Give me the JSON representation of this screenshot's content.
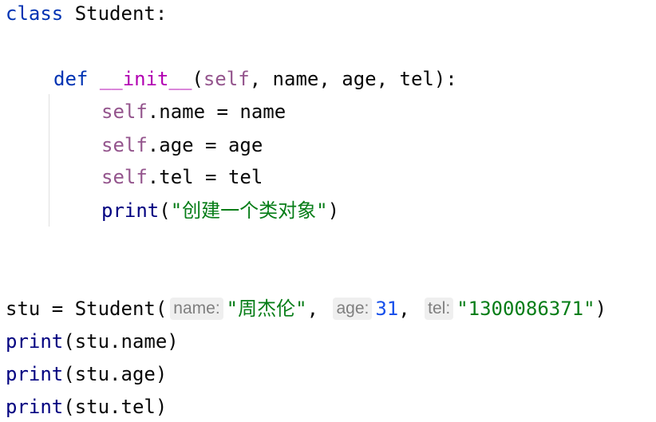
{
  "code": {
    "line1": {
      "kw": "class",
      "name": " Student:"
    },
    "line3": {
      "kw": "def",
      "space": " ",
      "fn": "__init__",
      "open": "(",
      "self": "self",
      "params": ", name, age, tel):"
    },
    "line4": {
      "self": "self",
      "rest": ".name = name"
    },
    "line5": {
      "self": "self",
      "rest": ".age = age"
    },
    "line6": {
      "self": "self",
      "rest": ".tel = tel"
    },
    "line7": {
      "fn": "print",
      "open": "(",
      "str": "\"创建一个类对象\"",
      "close": ")"
    },
    "line10": {
      "prefix": "stu = Student(",
      "hint_name": "name:",
      "arg_name": "\"周杰伦\"",
      "sep1": ", ",
      "hint_age": "age:",
      "arg_age": "31",
      "sep2": ", ",
      "hint_tel": "tel:",
      "arg_tel": "\"1300086371\"",
      "close": ")"
    },
    "line11": {
      "fn": "print",
      "rest": "(stu.name)"
    },
    "line12": {
      "fn": "print",
      "rest": "(stu.age)"
    },
    "line13": {
      "fn": "print",
      "rest": "(stu.tel)"
    }
  },
  "colors": {
    "keyword": "#0033b3",
    "dunder": "#b200b2",
    "self": "#94558d",
    "builtin": "#000080",
    "string": "#067d17",
    "number": "#1750eb",
    "hint_text": "#7f7f7f",
    "hint_bg": "#efefef"
  }
}
